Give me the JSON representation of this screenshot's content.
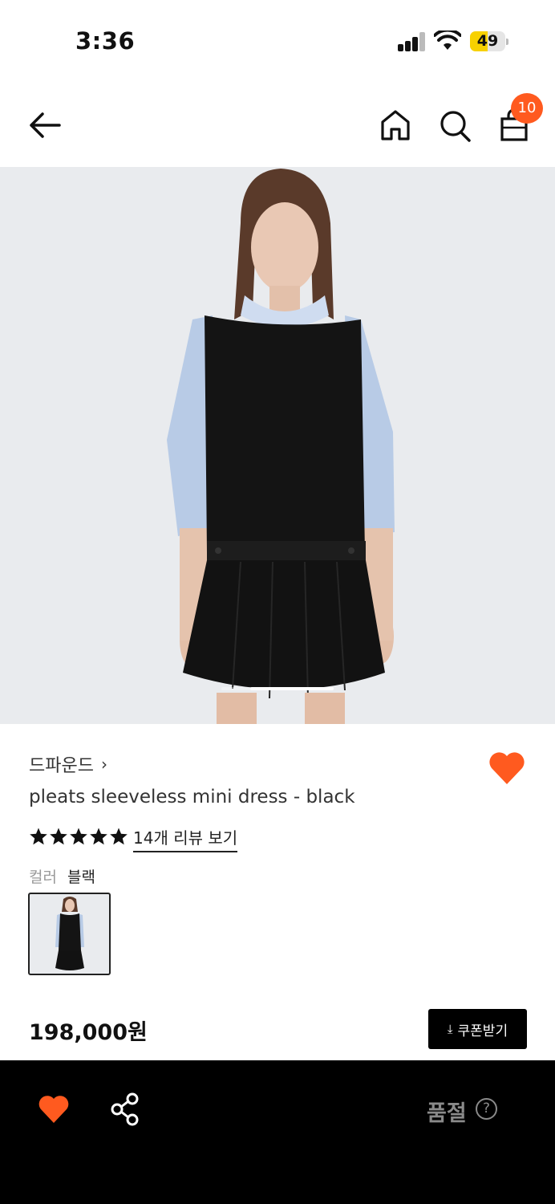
{
  "status_bar": {
    "time": "3:36",
    "battery": "49",
    "battery_level": 0.49
  },
  "header": {
    "cart_count": "10"
  },
  "product": {
    "brand": "드파운드",
    "brand_chevron": "›",
    "name": "pleats sleeveless mini dress - black",
    "rating_stars": 5,
    "review_link": "14개 리뷰 보기",
    "color_label": "컬러",
    "color_value": "블랙",
    "price": "198,000원",
    "wishlisted": true
  },
  "coupon_button": {
    "icon": "download-icon",
    "label": "쿠폰받기"
  },
  "bottom_bar": {
    "status": "품절",
    "help": "?"
  },
  "colors": {
    "accent": "#ff5a1f",
    "battery": "#f7d100",
    "bar_background": "#000000",
    "soldout_text": "#8a8a8a"
  }
}
